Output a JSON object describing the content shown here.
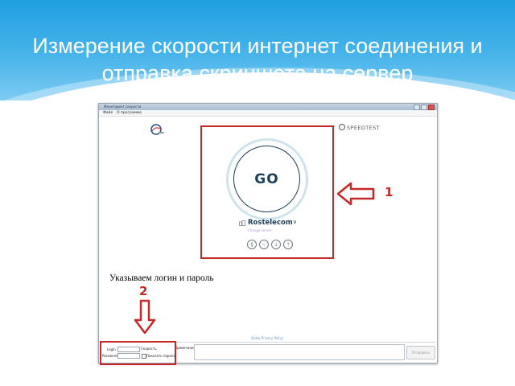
{
  "slide": {
    "title": "Измерение скорости интернет соединения и\nотправка скриншота на сервер"
  },
  "window": {
    "title": "Мониторинг скорости",
    "menu": [
      "Файл",
      "О программе"
    ]
  },
  "speedtest": {
    "brand": "SPEEDTEST",
    "go_label": "GO",
    "isp_name": "Rostelecom",
    "isp_sub": "Change server",
    "privacy_link": "Ookla Privacy Policy"
  },
  "annotations": {
    "marker_1": "1",
    "marker_2": "2",
    "note": "Указываем логин и пароль",
    "color": "#c62828"
  },
  "form": {
    "login_label": "Login",
    "password_label": "Password",
    "speed_label": "Скорость",
    "show_password_label": "Показать пароль",
    "comment_label": "Примечание",
    "send_label": "Отправить"
  }
}
